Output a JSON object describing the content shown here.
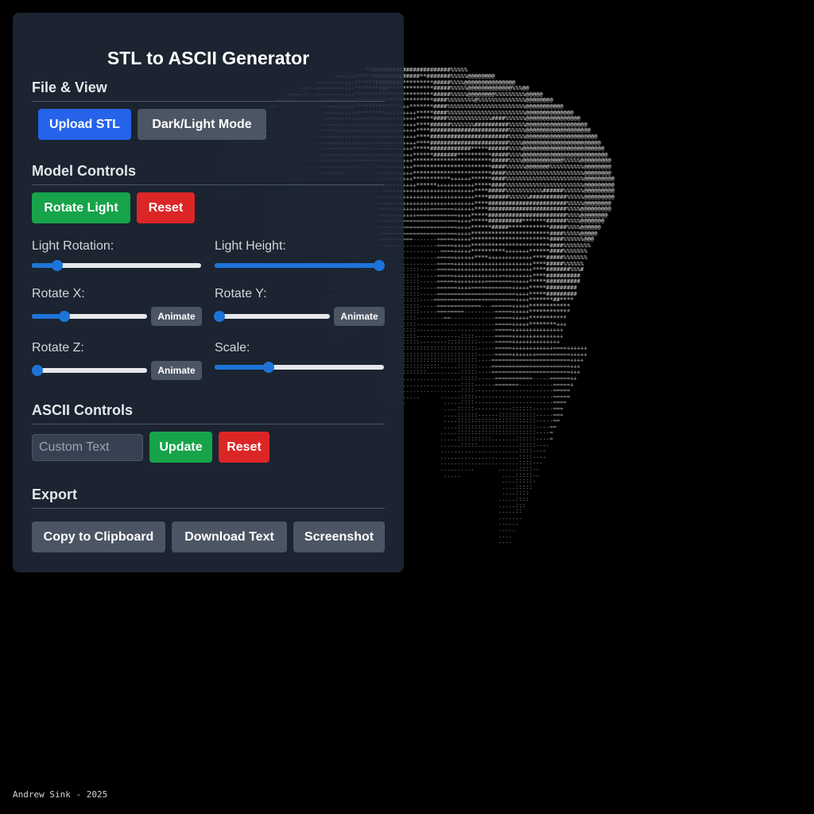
{
  "title": "STL to ASCII Generator",
  "sections": {
    "file_view": "File & View",
    "model_controls": "Model Controls",
    "ascii_controls": "ASCII Controls",
    "export": "Export"
  },
  "buttons": {
    "upload_stl": "Upload STL",
    "dark_light_mode": "Dark/Light Mode",
    "rotate_light": "Rotate Light",
    "reset_model": "Reset",
    "animate": "Animate",
    "update": "Update",
    "reset_ascii": "Reset",
    "copy_clipboard": "Copy to Clipboard",
    "download_text": "Download Text",
    "screenshot": "Screenshot"
  },
  "sliders": {
    "light_rotation": {
      "label": "Light Rotation:",
      "value": 0.15
    },
    "light_height": {
      "label": "Light Height:",
      "value": 0.97
    },
    "rotate_x": {
      "label": "Rotate X:",
      "value": 0.28
    },
    "rotate_y": {
      "label": "Rotate Y:",
      "value": 0.04
    },
    "rotate_z": {
      "label": "Rotate Z:",
      "value": 0.05
    },
    "scale": {
      "label": "Scale:",
      "value": 0.32
    }
  },
  "custom_text": {
    "placeholder": "Custom Text",
    "value": ""
  },
  "footer": "Andrew Sink - 2025",
  "colors": {
    "panel_bg": "#1f2937",
    "accent_blue": "#2563eb",
    "accent_green": "#16a34a",
    "accent_red": "#dc2626",
    "slider_blue": "#1d74d8"
  }
}
